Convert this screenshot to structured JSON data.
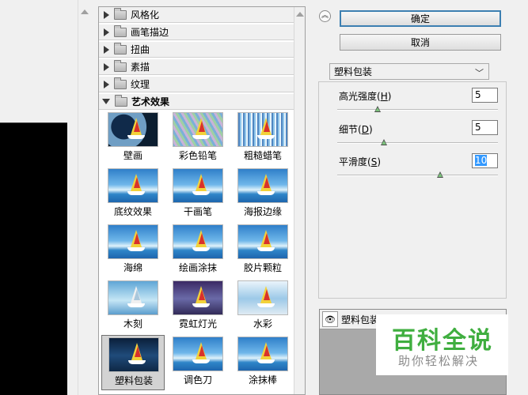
{
  "gallery": {
    "categories": [
      {
        "label": "风格化",
        "expanded": false
      },
      {
        "label": "画笔描边",
        "expanded": false
      },
      {
        "label": "扭曲",
        "expanded": false
      },
      {
        "label": "素描",
        "expanded": false
      },
      {
        "label": "纹理",
        "expanded": false
      },
      {
        "label": "艺术效果",
        "expanded": true
      }
    ],
    "filters": [
      {
        "label": "壁画",
        "effect": "fresco"
      },
      {
        "label": "彩色铅笔",
        "effect": "sketch"
      },
      {
        "label": "粗糙蜡笔",
        "effect": "rough"
      },
      {
        "label": "底纹效果",
        "effect": "normal"
      },
      {
        "label": "干画笔",
        "effect": "normal"
      },
      {
        "label": "海报边缘",
        "effect": "normal"
      },
      {
        "label": "海绵",
        "effect": "normal"
      },
      {
        "label": "绘画涂抹",
        "effect": "normal"
      },
      {
        "label": "胶片颗粒",
        "effect": "normal"
      },
      {
        "label": "木刻",
        "effect": "wood"
      },
      {
        "label": "霓虹灯光",
        "effect": "neon"
      },
      {
        "label": "水彩",
        "effect": "mono"
      },
      {
        "label": "塑料包装",
        "effect": "dark",
        "selected": true
      },
      {
        "label": "调色刀",
        "effect": "normal"
      },
      {
        "label": "涂抹棒",
        "effect": "normal"
      }
    ]
  },
  "toolbar": {
    "toggle_icon": "chevron-double-up-icon",
    "ok_label": "确定",
    "cancel_label": "取消"
  },
  "filter_select": {
    "value": "塑料包装"
  },
  "params": [
    {
      "label": "高光强度",
      "key": "H",
      "value": "5",
      "fraction": 0.25
    },
    {
      "label": "细节",
      "key": "D",
      "value": "5",
      "fraction": 0.29
    },
    {
      "label": "平滑度",
      "key": "S",
      "value": "10",
      "fraction": 0.64
    }
  ],
  "layer": {
    "name": "塑料包装"
  },
  "watermark": {
    "title": "百科全说",
    "subtitle": "助你轻松解决"
  },
  "colors": {
    "accent": "#3c7fb1",
    "watermark_green": "#3fae3f",
    "selection": "#3399ff"
  }
}
